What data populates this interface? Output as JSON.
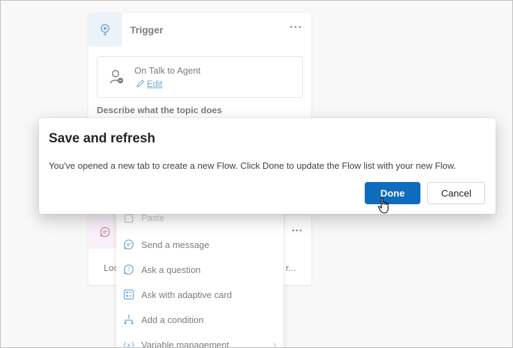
{
  "trigger_card": {
    "title": "Trigger",
    "more": "···",
    "trigger_name": "On Talk to Agent",
    "edit_label": "Edit",
    "describe_label": "Describe what the topic does"
  },
  "message_card": {
    "more": "···",
    "text_left": "Loc",
    "text_right": "r..."
  },
  "menu": {
    "items": [
      {
        "label": "Paste",
        "icon": "paste-icon",
        "disabled": true
      },
      {
        "label": "Send a message",
        "icon": "chat-icon"
      },
      {
        "label": "Ask a question",
        "icon": "question-bubble-icon"
      },
      {
        "label": "Ask with adaptive card",
        "icon": "adaptive-card-icon"
      },
      {
        "label": "Add a condition",
        "icon": "branch-icon"
      },
      {
        "label": "Variable management",
        "icon": "variable-icon",
        "has_submenu": true
      }
    ]
  },
  "dialog": {
    "title": "Save and refresh",
    "body": "You've opened a new tab to create a new Flow. Click Done to update the Flow list with your new Flow.",
    "done_label": "Done",
    "cancel_label": "Cancel"
  },
  "colors": {
    "accent": "#0f6cbd",
    "trigger_icon_bg": "#dfe9f5",
    "message_icon_bg": "#f5e6f3"
  }
}
